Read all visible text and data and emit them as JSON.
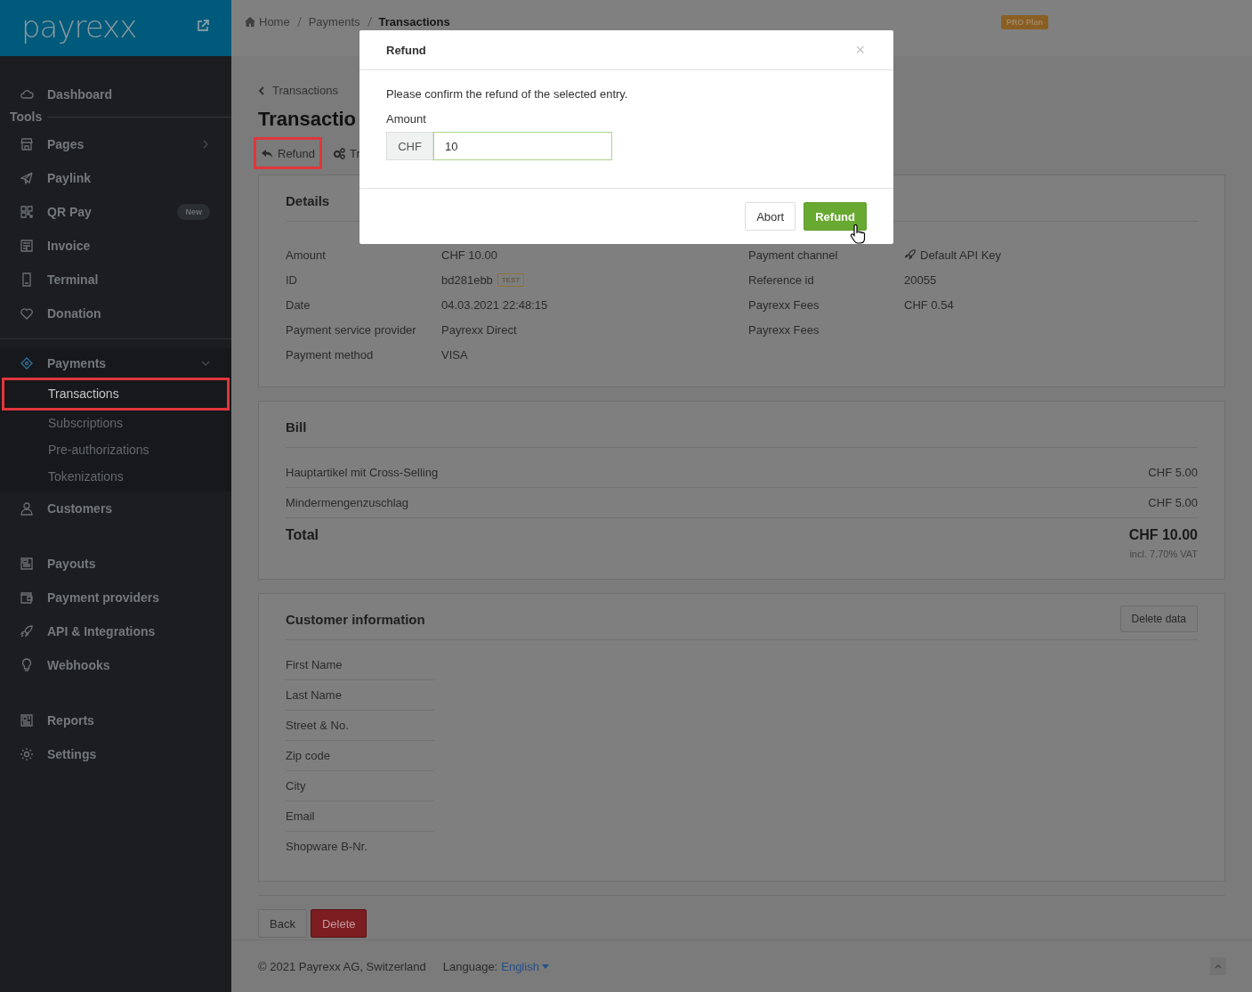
{
  "sidebar": {
    "logo": "payrexx",
    "sections": [
      {
        "items": [
          {
            "label": "Dashboard",
            "selected": false
          }
        ]
      },
      {
        "heading": "Tools",
        "items": [
          {
            "label": "Pages",
            "selected": false,
            "has_submenu": true
          },
          {
            "label": "Paylink",
            "selected": false
          },
          {
            "label": "QR Pay",
            "selected": false,
            "badge": "New"
          },
          {
            "label": "Invoice",
            "selected": false
          },
          {
            "label": "Terminal",
            "selected": false
          },
          {
            "label": "Donation",
            "selected": false
          }
        ]
      },
      {
        "items": [
          {
            "label": "Payments",
            "selected": false,
            "expanded": true,
            "children": [
              {
                "label": "Transactions",
                "selected": true,
                "highlighted": true
              },
              {
                "label": "Subscriptions",
                "selected": false,
                "highlighted": false
              },
              {
                "label": "Pre-authorizations",
                "selected": false,
                "highlighted": false
              },
              {
                "label": "Tokenizations",
                "selected": false,
                "highlighted": false
              }
            ]
          },
          {
            "label": "Customers",
            "selected": false
          }
        ]
      },
      {
        "items": [
          {
            "label": "Payouts",
            "selected": false
          },
          {
            "label": "Payment providers",
            "selected": false
          },
          {
            "label": "API & Integrations",
            "selected": false
          },
          {
            "label": "Webhooks",
            "selected": false
          }
        ]
      },
      {
        "items": [
          {
            "label": "Reports",
            "selected": false
          },
          {
            "label": "Settings",
            "selected": false
          }
        ]
      }
    ]
  },
  "topbar": {
    "breadcrumb": [
      "Home",
      "Payments",
      "Transactions"
    ],
    "plan_badge": "PRO Plan"
  },
  "page": {
    "back_link": "Transactions",
    "title": "Transactio",
    "toolbar": [
      {
        "label": "Refund",
        "highlighted": true
      },
      {
        "label": "Tr",
        "highlighted": false
      }
    ],
    "details": {
      "title": "Details",
      "left": [
        {
          "label": "Amount",
          "value": "CHF 10.00"
        },
        {
          "label": "ID",
          "value": "bd281ebb",
          "badge": "TEST"
        },
        {
          "label": "Date",
          "value": "04.03.2021 22:48:15"
        },
        {
          "label": "Payment service provider",
          "value": "Payrexx Direct"
        },
        {
          "label": "Payment method",
          "value": "VISA"
        }
      ],
      "right": [
        {
          "label": "Payment channel",
          "value": "Default API Key"
        },
        {
          "label": "Reference id",
          "value": "20055"
        },
        {
          "label": "Payrexx Fees",
          "value": "CHF 0.54"
        },
        {
          "label": "Payrexx Fees"
        }
      ]
    },
    "bill": {
      "title": "Bill",
      "lines": [
        {
          "name": "Hauptartikel mit Cross-Selling",
          "price": "CHF 5.00"
        },
        {
          "name": "Mindermengenzuschlag",
          "price": "CHF 5.00"
        }
      ],
      "total_label": "Total",
      "total": "CHF 10.00",
      "vat_note": "incl. 7.70% VAT"
    },
    "customer": {
      "title": "Customer information",
      "action": "Delete data",
      "fields": [
        "First Name",
        "Last Name",
        "Street & No.",
        "Zip code",
        "City",
        "Email",
        "Shopware B-Nr."
      ]
    },
    "buttons": [
      {
        "label": "Back",
        "kind": "default"
      },
      {
        "label": "Delete",
        "kind": "danger"
      }
    ]
  },
  "footer": {
    "copyright": "© 2021 Payrexx AG, Switzerland",
    "language_label": "Language:",
    "language": "English"
  },
  "modal": {
    "title": "Refund",
    "close": "×",
    "message": "Please confirm the refund of the selected entry.",
    "field_label": "Amount",
    "currency": "CHF",
    "value": "10",
    "buttons": [
      {
        "label": "Abort",
        "kind": "default"
      },
      {
        "label": "Refund",
        "kind": "primary"
      }
    ]
  }
}
